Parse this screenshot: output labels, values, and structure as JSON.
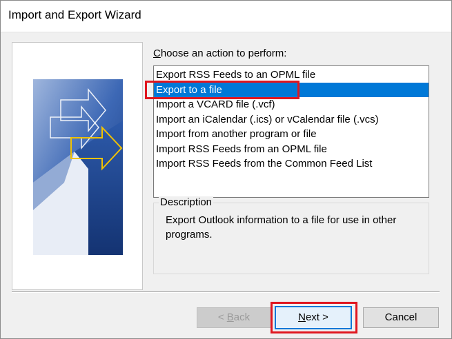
{
  "window": {
    "title": "Import and Export Wizard"
  },
  "prompt": {
    "label_prefix": "C",
    "label_rest": "hoose an action to perform:"
  },
  "actions": [
    {
      "label": "Export RSS Feeds to an OPML file"
    },
    {
      "label": "Export to a file",
      "selected": true
    },
    {
      "label": "Import a VCARD file (.vcf)"
    },
    {
      "label": "Import an iCalendar (.ics) or vCalendar file (.vcs)"
    },
    {
      "label": "Import from another program or file"
    },
    {
      "label": "Import RSS Feeds from an OPML file"
    },
    {
      "label": "Import RSS Feeds from the Common Feed List"
    }
  ],
  "description": {
    "legend": "Description",
    "text": "Export Outlook information to a file for use in other programs."
  },
  "buttons": {
    "back_prefix": "< ",
    "back_key": "B",
    "back_rest": "ack",
    "next_key": "N",
    "next_rest": "ext >",
    "cancel": "Cancel"
  },
  "colors": {
    "selection": "#0078d7",
    "highlight": "#e0161f",
    "art_dark": "#1f4e9c",
    "art_accent": "#f2c200"
  }
}
